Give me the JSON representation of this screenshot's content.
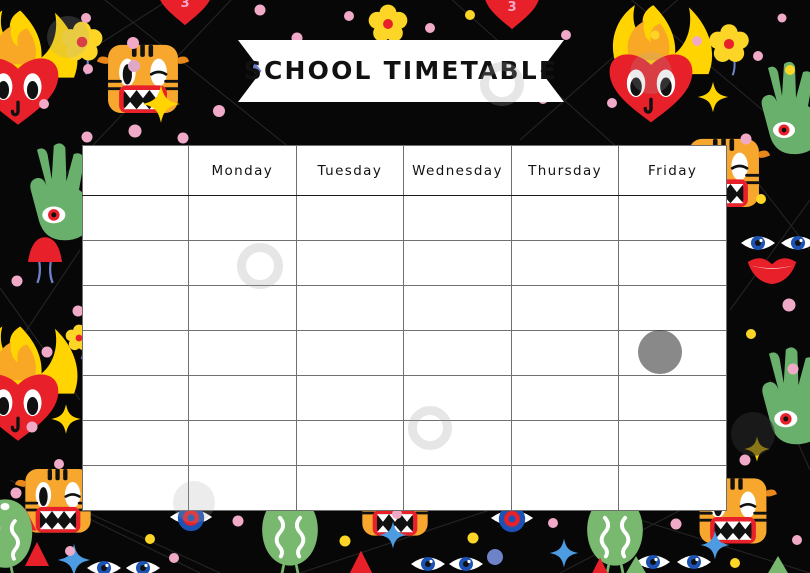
{
  "poster": {
    "background_color": "#070707",
    "title": "SCHOOL  TIMETABLE",
    "title_banner_color": "#ffffff",
    "title_text_color": "#111111"
  },
  "timetable": {
    "columns": [
      {
        "label": "",
        "name": "time-column"
      },
      {
        "label": "Monday",
        "name": "column-monday"
      },
      {
        "label": "Tuesday",
        "name": "column-tuesday"
      },
      {
        "label": "Wednesday",
        "name": "column-wednesday"
      },
      {
        "label": "Thursday",
        "name": "column-thursday"
      },
      {
        "label": "Friday",
        "name": "column-friday"
      }
    ],
    "row_count": 7,
    "rows": [
      {
        "time": "",
        "cells": [
          "",
          "",
          "",
          "",
          ""
        ]
      },
      {
        "time": "",
        "cells": [
          "",
          "",
          "",
          "",
          ""
        ]
      },
      {
        "time": "",
        "cells": [
          "",
          "",
          "",
          "",
          ""
        ]
      },
      {
        "time": "",
        "cells": [
          "",
          "",
          "",
          "",
          ""
        ]
      },
      {
        "time": "",
        "cells": [
          "",
          "",
          "",
          "",
          ""
        ]
      },
      {
        "time": "",
        "cells": [
          "",
          "",
          "",
          "",
          ""
        ]
      },
      {
        "time": "",
        "cells": [
          "",
          "",
          "",
          "",
          ""
        ]
      }
    ],
    "grid_color": "#6f6f6f",
    "cell_background": "#ffffff"
  },
  "decorations": {
    "palette": {
      "flame_yellow": "#ffd400",
      "flame_orange": "#f9a826",
      "heart_red": "#e8202a",
      "tiger_orange": "#f7a72e",
      "tiger_dark_orange": "#e8881c",
      "cactus_green": "#6ab06d",
      "snake_green": "#79b86f",
      "flower_yellow": "#fcd527",
      "flower_center_red": "#e8202a",
      "dot_pink": "#f0aac8",
      "dot_blue": "#6e82c8",
      "dot_yellow": "#fcd527",
      "eye_blue": "#1c52b3",
      "lips_red": "#e8202a",
      "sparkle_yellow": "#ffd400",
      "sparkle_blue": "#4d9be0",
      "white": "#ffffff",
      "black": "#111111"
    },
    "items": [
      {
        "name": "flaming-heart",
        "label": "flaming heart face"
      },
      {
        "name": "tiger-face",
        "label": "tiger face"
      },
      {
        "name": "flower",
        "label": "yellow flower"
      },
      {
        "name": "cactus-hand",
        "label": "green hand with eye"
      },
      {
        "name": "heart-balloon",
        "label": "red heart with number 3"
      },
      {
        "name": "mushroom",
        "label": "red mushrooms"
      },
      {
        "name": "snake-head",
        "label": "green snake head"
      },
      {
        "name": "eye",
        "label": "blue eye"
      },
      {
        "name": "lips",
        "label": "red lips"
      },
      {
        "name": "sparkle",
        "label": "four point sparkle"
      },
      {
        "name": "target-eye",
        "label": "blue red target eye"
      },
      {
        "name": "confetti-dot",
        "label": "confetti dot"
      }
    ],
    "heart_balloon_number": "3"
  }
}
